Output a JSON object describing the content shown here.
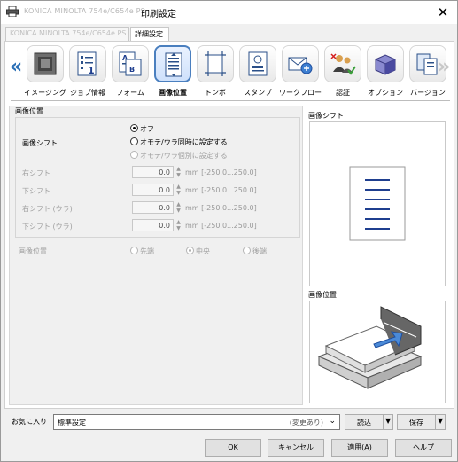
{
  "window": {
    "printer_name": "KONICA MINOLTA 754e/C654e PS",
    "title": "印刷設定",
    "close_glyph": "✕"
  },
  "tabs": [
    {
      "label": "KONICA MINOLTA 754e/C654e PS",
      "active": false
    },
    {
      "label": "詳細設定",
      "active": true
    }
  ],
  "toolbar": {
    "prev_glyph": "«",
    "next_glyph": "»",
    "items": [
      {
        "label": "イメージング",
        "icon": "imaging-icon",
        "selected": false
      },
      {
        "label": "ジョブ情報",
        "icon": "job-info-icon",
        "selected": false
      },
      {
        "label": "フォーム",
        "icon": "form-icon",
        "selected": false
      },
      {
        "label": "画像位置",
        "icon": "image-position-icon",
        "selected": true
      },
      {
        "label": "トンボ",
        "icon": "crop-marks-icon",
        "selected": false
      },
      {
        "label": "スタンプ",
        "icon": "stamp-icon",
        "selected": false
      },
      {
        "label": "ワークフロー",
        "icon": "workflow-icon",
        "selected": false
      },
      {
        "label": "認証",
        "icon": "authentication-icon",
        "selected": false
      },
      {
        "label": "オプション",
        "icon": "options-icon",
        "selected": false
      },
      {
        "label": "バージョン",
        "icon": "version-icon",
        "selected": false
      }
    ]
  },
  "settings": {
    "group_title": "画像位置",
    "image_shift_label": "画像シフト",
    "shift_options": [
      {
        "label": "オフ",
        "checked": true,
        "disabled": false
      },
      {
        "label": "オモテ/ウラ同時に設定する",
        "checked": false,
        "disabled": false
      },
      {
        "label": "オモテ/ウラ個別に設定する",
        "checked": false,
        "disabled": true
      }
    ],
    "fields": [
      {
        "label": "右シフト",
        "value": "0.0",
        "unit_range": "mm [-250.0...250.0]"
      },
      {
        "label": "下シフト",
        "value": "0.0",
        "unit_range": "mm [-250.0...250.0]"
      },
      {
        "label": "右シフト (ウラ)",
        "value": "0.0",
        "unit_range": "mm [-250.0...250.0]"
      },
      {
        "label": "下シフト (ウラ)",
        "value": "0.0",
        "unit_range": "mm [-250.0...250.0]"
      }
    ],
    "position_label": "画像位置",
    "position_options": [
      {
        "label": "先端",
        "checked": false
      },
      {
        "label": "中央",
        "checked": true
      },
      {
        "label": "後端",
        "checked": false
      }
    ]
  },
  "preview": {
    "shift_title": "画像シフト",
    "position_title": "画像位置"
  },
  "favorites": {
    "label": "お気に入り",
    "value": "標準設定",
    "changed_note": "(変更あり)",
    "load_label": "読込",
    "save_label": "保存"
  },
  "buttons": {
    "ok": "OK",
    "cancel": "キャンセル",
    "apply": "適用(A)",
    "help": "ヘルプ"
  },
  "colors": {
    "accent": "#2a6fb6",
    "selected_border": "#4a7fbf",
    "preview_lines": "#1f3f8f"
  }
}
